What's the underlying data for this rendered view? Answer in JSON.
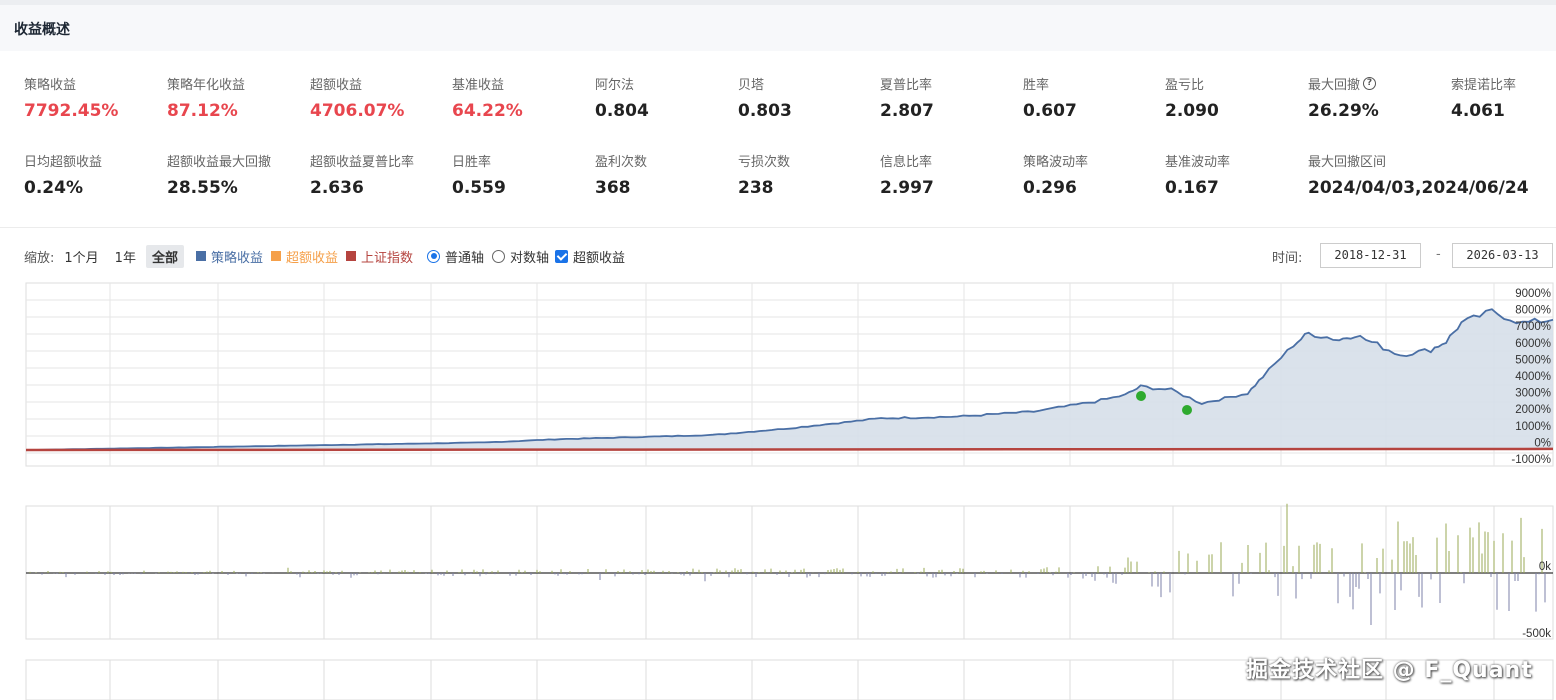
{
  "section_title": "收益概述",
  "metrics_row1": [
    {
      "label": "策略收益",
      "value": "7792.45%",
      "red": true
    },
    {
      "label": "策略年化收益",
      "value": "87.12%",
      "red": true
    },
    {
      "label": "超额收益",
      "value": "4706.07%",
      "red": true
    },
    {
      "label": "基准收益",
      "value": "64.22%",
      "red": true
    },
    {
      "label": "阿尔法",
      "value": "0.804",
      "red": false
    },
    {
      "label": "贝塔",
      "value": "0.803",
      "red": false
    },
    {
      "label": "夏普比率",
      "value": "2.807",
      "red": false
    },
    {
      "label": "胜率",
      "value": "0.607",
      "red": false
    },
    {
      "label": "盈亏比",
      "value": "2.090",
      "red": false
    },
    {
      "label": "最大回撤",
      "value": "26.29%",
      "red": false,
      "help": "?"
    },
    {
      "label": "索提诺比率",
      "value": "4.061",
      "red": false
    }
  ],
  "metrics_row2": [
    {
      "label": "日均超额收益",
      "value": "0.24%"
    },
    {
      "label": "超额收益最大回撤",
      "value": "28.55%"
    },
    {
      "label": "超额收益夏普比率",
      "value": "2.636"
    },
    {
      "label": "日胜率",
      "value": "0.559"
    },
    {
      "label": "盈利次数",
      "value": "368"
    },
    {
      "label": "亏损次数",
      "value": "238"
    },
    {
      "label": "信息比率",
      "value": "2.997"
    },
    {
      "label": "策略波动率",
      "value": "0.296"
    },
    {
      "label": "基准波动率",
      "value": "0.167"
    },
    {
      "label": "最大回撤区间",
      "value": "2024/04/03,2024/06/24"
    }
  ],
  "toolbar": {
    "zoom_label": "缩放:",
    "zoom_buttons": [
      "1个月",
      "1年",
      "全部"
    ],
    "legend": [
      {
        "label": "策略收益",
        "color": "#4a6fa5"
      },
      {
        "label": "超额收益",
        "color": "#f5a04a"
      },
      {
        "label": "上证指数",
        "color": "#b5443f"
      }
    ],
    "axis_options": [
      "普通轴",
      "对数轴"
    ],
    "excess_checkbox": "超额收益",
    "time_label": "时间:",
    "start_date": "2018-12-31",
    "end_date": "2026-03-13",
    "date_separator": "-"
  },
  "watermark": "掘金技术社区 @ F_Quant",
  "colors": {
    "strategy": "#4a6fa5",
    "benchmark": "#b5443f",
    "profit_bar": "#9aa955",
    "loss_bar": "#7c80a8",
    "marker": "#2eaa2e"
  },
  "chart_data": [
    {
      "type": "area",
      "series": [
        {
          "name": "策略收益",
          "x": [
            0,
            0.1,
            0.2,
            0.3,
            0.35,
            0.45,
            0.5,
            0.54,
            0.56,
            0.61,
            0.66,
            0.7,
            0.72,
            0.73,
            0.75,
            0.77,
            0.8,
            0.81,
            0.83,
            0.84,
            0.86,
            0.87,
            0.9,
            0.92,
            0.93,
            0.94,
            0.96,
            0.98,
            1.0
          ],
          "values": [
            0,
            150,
            300,
            450,
            650,
            900,
            1300,
            1700,
            1900,
            2000,
            2300,
            2900,
            3300,
            3800,
            3600,
            2800,
            3400,
            4400,
            6300,
            7000,
            6600,
            6900,
            5700,
            6000,
            6500,
            7600,
            8300,
            7600,
            7800
          ]
        },
        {
          "name": "上证指数",
          "x": [
            0,
            1
          ],
          "values": [
            0,
            64
          ]
        }
      ],
      "yticks": [
        "9000%",
        "8000%",
        "7000%",
        "6000%",
        "5000%",
        "4000%",
        "3000%",
        "2000%",
        "1000%",
        "0%",
        "-1000%"
      ],
      "ylim": [
        -1000,
        9000
      ]
    },
    {
      "type": "bar",
      "yticks": [
        "0k",
        "-500k"
      ]
    }
  ]
}
